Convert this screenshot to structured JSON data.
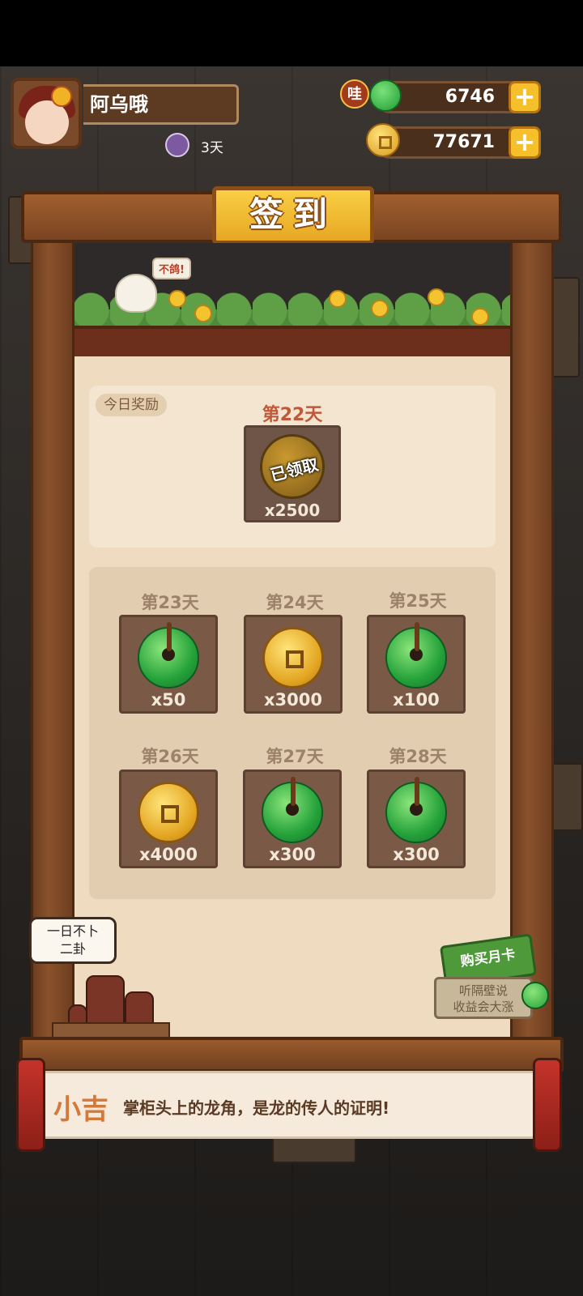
{
  "player": {
    "name": "阿乌哦",
    "days": "3天"
  },
  "currency": {
    "jade_badge": "哇",
    "jade_amount": "6746",
    "coin_amount": "77671",
    "plus": "+"
  },
  "checkin": {
    "title": "签到",
    "scene_bubble": "不鸽!",
    "today_tag": "今日奖励",
    "today": {
      "day": "第22天",
      "status": "已领取",
      "qty": "x2500",
      "icon": "coin-icon"
    },
    "upcoming": [
      {
        "day": "第23天",
        "qty": "x50",
        "icon": "jade-icon"
      },
      {
        "day": "第24天",
        "qty": "x3000",
        "icon": "coin-icon"
      },
      {
        "day": "第25天",
        "qty": "x100",
        "icon": "jade-icon"
      },
      {
        "day": "第26天",
        "qty": "x4000",
        "icon": "coin-icon"
      },
      {
        "day": "第27天",
        "qty": "x300",
        "icon": "jade-icon"
      },
      {
        "day": "第28天",
        "qty": "x300",
        "icon": "jade-icon"
      }
    ]
  },
  "props": {
    "speech_line1": "一日不卜",
    "speech_line2": "二卦",
    "month_card_title": "购买月卡",
    "month_card_line1": "听隔壁说",
    "month_card_line2": "收益会大涨"
  },
  "dialog": {
    "speaker": "小吉",
    "text": "掌柜头上的龙角，是龙的传人的证明!"
  },
  "colors": {
    "wood": "#7a4422",
    "plaque": "#f2b930",
    "panel": "#efdcc0",
    "jade": "#25a23a",
    "coin": "#e3a521",
    "accent_red": "#c0583a"
  }
}
